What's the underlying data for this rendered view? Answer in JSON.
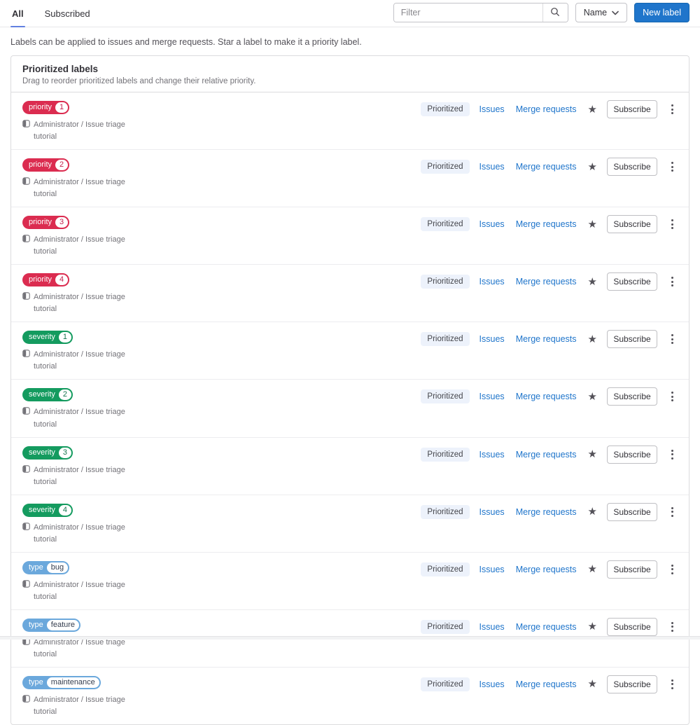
{
  "tabs": [
    {
      "label": "All",
      "active": true
    },
    {
      "label": "Subscribed",
      "active": false
    }
  ],
  "toolbar": {
    "filter_placeholder": "Filter",
    "sort_button_label": "Name",
    "new_label_button": "New label"
  },
  "description": "Labels can be applied to issues and merge requests. Star a label to make it a priority label.",
  "prioritized_card": {
    "title": "Prioritized labels",
    "subtitle": "Drag to reorder prioritized labels and change their relative priority."
  },
  "row_shared": {
    "project_path": "Administrator / Issue triage tutorial",
    "prioritized_badge": "Prioritized",
    "issues_link": "Issues",
    "merge_requests_link": "Merge requests",
    "subscribe_button": "Subscribe"
  },
  "labels": [
    {
      "scope": "priority",
      "value": "1",
      "color": "#db2c50",
      "value_color": "#c41e4a"
    },
    {
      "scope": "priority",
      "value": "2",
      "color": "#db2c50",
      "value_color": "#c41e4a"
    },
    {
      "scope": "priority",
      "value": "3",
      "color": "#db2c50",
      "value_color": "#c41e4a"
    },
    {
      "scope": "priority",
      "value": "4",
      "color": "#db2c50",
      "value_color": "#c41e4a"
    },
    {
      "scope": "severity",
      "value": "1",
      "color": "#149b5f",
      "value_color": "#15754e"
    },
    {
      "scope": "severity",
      "value": "2",
      "color": "#149b5f",
      "value_color": "#15754e"
    },
    {
      "scope": "severity",
      "value": "3",
      "color": "#149b5f",
      "value_color": "#15754e"
    },
    {
      "scope": "severity",
      "value": "4",
      "color": "#149b5f",
      "value_color": "#15754e"
    },
    {
      "scope": "type",
      "value": "bug",
      "color": "#6ba8dc",
      "value_color": "#333c4e"
    },
    {
      "scope": "type",
      "value": "feature",
      "color": "#6ba8dc",
      "value_color": "#333c4e"
    },
    {
      "scope": "type",
      "value": "maintenance",
      "color": "#6ba8dc",
      "value_color": "#333c4e"
    }
  ],
  "icons": {
    "search": "search-icon",
    "chevron": "chevron-down-icon",
    "project": "project-icon",
    "star": "star-icon",
    "kebab": "vertical-dots-icon"
  },
  "colors": {
    "accent_blue": "#1f75cb",
    "tab_indicator": "#6180e0",
    "priority_red": "#db2c50",
    "severity_green": "#149b5f",
    "type_blue": "#6ba8dc",
    "badge_bg": "#edf2fb",
    "muted_text": "#737278",
    "border": "#dcdcde"
  }
}
